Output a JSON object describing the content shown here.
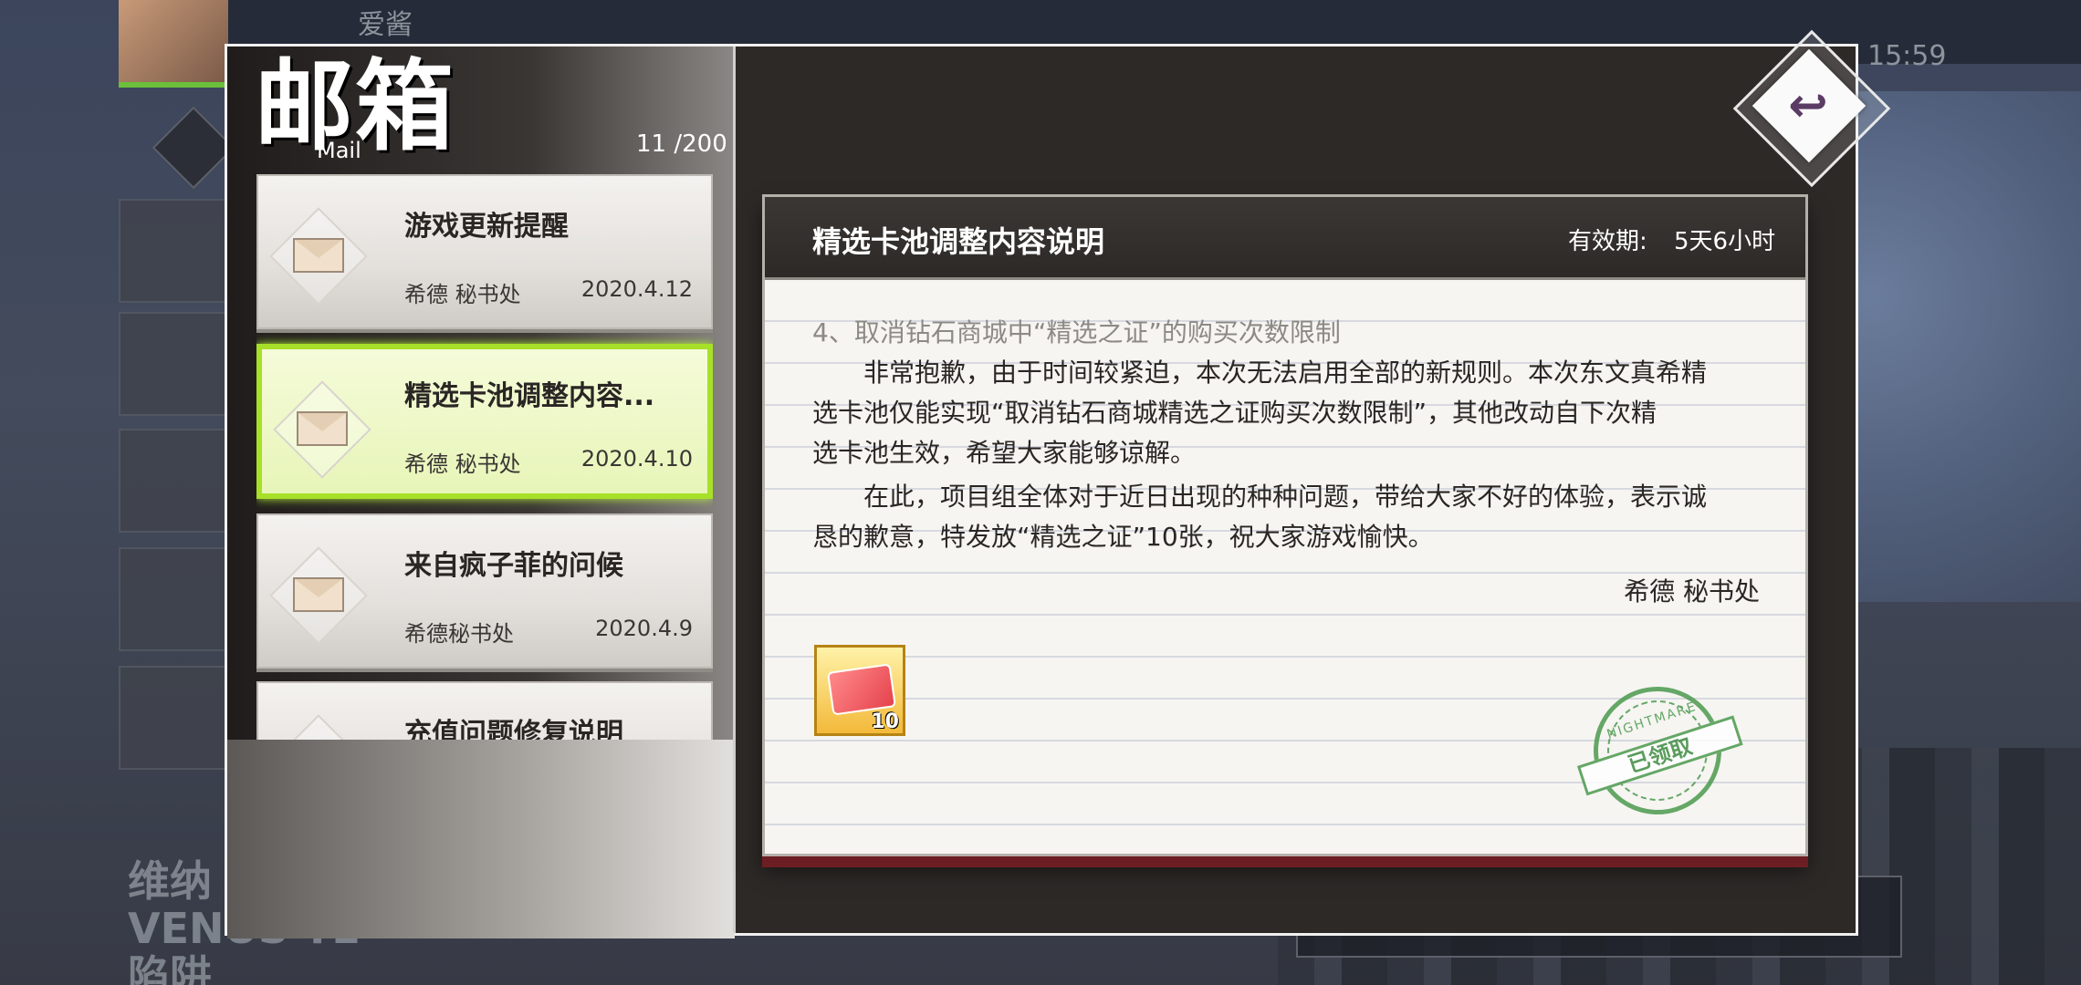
{
  "background": {
    "player_name": "爱酱",
    "clock": "15:59",
    "event_title": "维纳\nVENUS TE\n陷阱"
  },
  "mailbox": {
    "title": "邮箱",
    "title_en": "Mail",
    "count": "11  /200",
    "mails": [
      {
        "subject": "游戏更新提醒",
        "sender": "希德 秘书处",
        "date": "2020.4.12",
        "selected": false
      },
      {
        "subject": "精选卡池调整内容...",
        "sender": "希德 秘书处",
        "date": "2020.4.10",
        "selected": true
      },
      {
        "subject": "来自疯子菲的问候",
        "sender": "希德秘书处",
        "date": "2020.4.9",
        "selected": false
      },
      {
        "subject": "充值问题修复说明",
        "sender": "",
        "date": "",
        "selected": false
      }
    ]
  },
  "letter": {
    "title": "精选卡池调整内容说明",
    "validity_label": "有效期:",
    "validity_value": "5天6小时",
    "lines": [
      "4、取消钻石商城中“精选之证”的购买次数限制",
      "　　非常抱歉，由于时间较紧迫，本次无法启用全部的新规则。本次东文真希精",
      "选卡池仅能实现“取消钻石商城精选之证购买次数限制”，其他改动自下次精",
      "选卡池生效，希望大家能够谅解。",
      "　　在此，项目组全体对于近日出现的种种问题，带给大家不好的体验，表示诚",
      "恳的歉意，特发放“精选之证”10张，祝大家游戏愉快。"
    ],
    "signature": "希德 秘书处",
    "reward": {
      "icon": "ticket-icon",
      "quantity": "10"
    },
    "stamp": {
      "brand": "NIGHTMARE",
      "status": "已领取"
    }
  },
  "colors": {
    "selected_border": "#a7e028",
    "stamp_green": "#4c9a4e",
    "header_dark": "#2c2927"
  }
}
